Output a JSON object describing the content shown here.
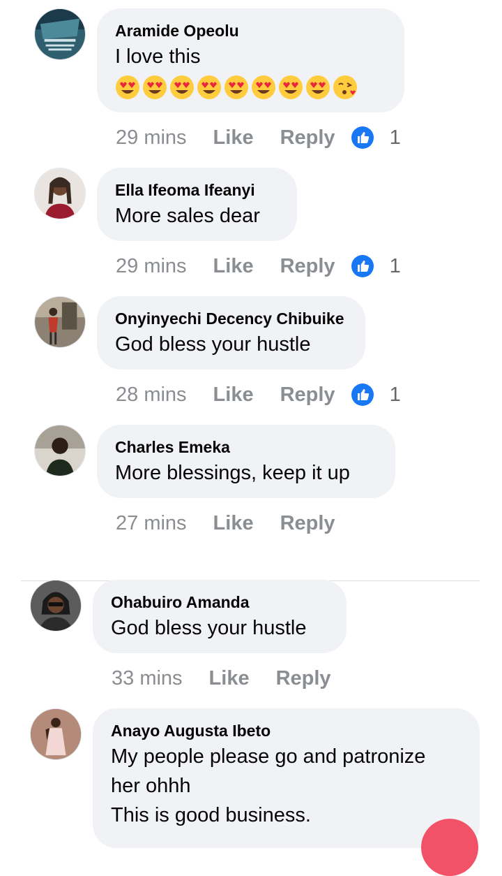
{
  "colors": {
    "bubble": "#f0f2f5",
    "meta_text": "#8a8d91",
    "like_blue": "#1877f2",
    "fab": "#f25268"
  },
  "comments": [
    {
      "author": "Aramide Opeolu",
      "text": "I love this",
      "emojis": [
        "heart-eyes-emoji",
        "heart-eyes-emoji",
        "heart-eyes-emoji",
        "heart-eyes-emoji",
        "heart-eyes-emoji",
        "heart-eyes-emoji",
        "heart-eyes-emoji",
        "heart-eyes-emoji",
        "kissing-heart-emoji"
      ],
      "time": "29 mins",
      "like_label": "Like",
      "reply_label": "Reply",
      "reaction_icon": "like-reaction-icon",
      "reaction_count": "1"
    },
    {
      "author": "Ella Ifeoma Ifeanyi",
      "text": "More sales dear",
      "time": "29 mins",
      "like_label": "Like",
      "reply_label": "Reply",
      "reaction_icon": "like-reaction-icon",
      "reaction_count": "1"
    },
    {
      "author": "Onyinyechi Decency Chibuike",
      "text": "God bless your hustle",
      "time": "28 mins",
      "like_label": "Like",
      "reply_label": "Reply",
      "reaction_icon": "like-reaction-icon",
      "reaction_count": "1"
    },
    {
      "author": "Charles Emeka",
      "text": "More blessings, keep it up",
      "time": "27 mins",
      "like_label": "Like",
      "reply_label": "Reply"
    },
    {
      "author": "Ohabuiro Amanda",
      "text": "God bless your hustle",
      "time": "33 mins",
      "like_label": "Like",
      "reply_label": "Reply"
    },
    {
      "author": "Anayo Augusta Ibeto",
      "text_lines": [
        "My people please go and patronize",
        "her ohhh",
        "This is good business."
      ]
    }
  ]
}
